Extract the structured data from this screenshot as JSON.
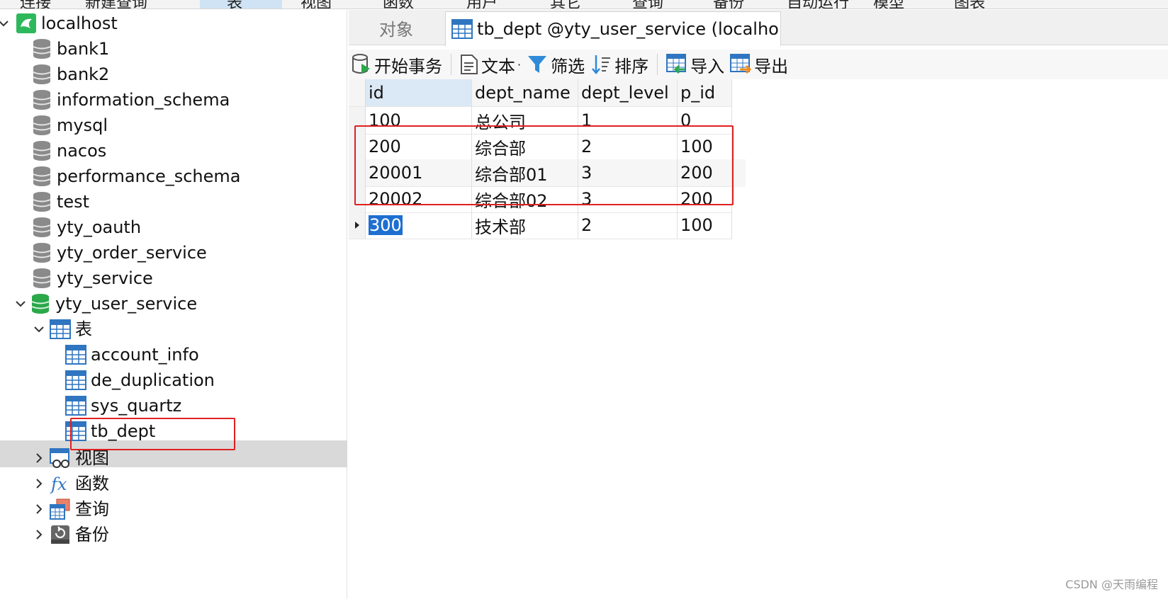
{
  "topbar": {
    "items": [
      "连接",
      "新建查询",
      "表",
      "视图",
      "函数",
      "用户",
      "其它",
      "查询",
      "备份",
      "自动运行",
      "模型",
      "图表"
    ]
  },
  "tree": {
    "connection": "localhost",
    "databases": [
      "bank1",
      "bank2",
      "information_schema",
      "mysql",
      "nacos",
      "performance_schema",
      "test",
      "yty_oauth",
      "yty_order_service",
      "yty_service"
    ],
    "open_database": "yty_user_service",
    "tables_group": "表",
    "tables": [
      "account_info",
      "de_duplication",
      "sys_quartz",
      "tb_dept"
    ],
    "selected_table": "tb_dept",
    "groups": [
      "视图",
      "函数",
      "查询",
      "备份"
    ]
  },
  "tabs": {
    "objects": "对象",
    "active": "tb_dept @yty_user_service (localho..."
  },
  "toolbar": {
    "begin_tx": "开始事务",
    "text": "文本",
    "filter": "筛选",
    "sort": "排序",
    "import": "导入",
    "export": "导出"
  },
  "grid": {
    "columns": [
      "id",
      "dept_name",
      "dept_level",
      "p_id"
    ],
    "rows": [
      [
        "100",
        "总公司",
        "1",
        "0"
      ],
      [
        "200",
        "综合部",
        "2",
        "100"
      ],
      [
        "20001",
        "综合部01",
        "3",
        "200"
      ],
      [
        "20002",
        "综合部02",
        "3",
        "200"
      ],
      [
        "300",
        "技术部",
        "2",
        "100"
      ]
    ]
  },
  "watermark": "CSDN @天雨编程",
  "colors": {
    "highlight": "#e02020",
    "selection": "#1e6fd1",
    "db_active": "#2aa84a"
  }
}
